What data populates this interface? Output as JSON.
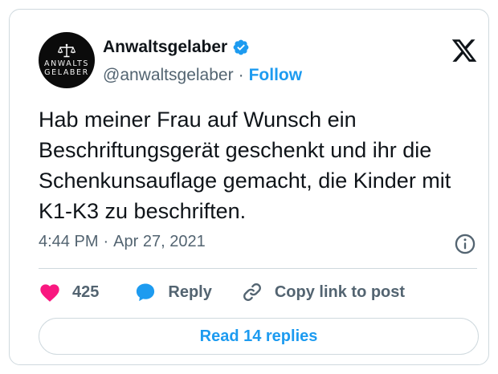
{
  "author": {
    "display_name": "Anwaltsgelaber",
    "handle": "@anwaltsgelaber",
    "separator": "·",
    "follow_label": "Follow",
    "avatar_text_top": "ANWALTS",
    "avatar_text_bottom": "GELABER",
    "verified": true
  },
  "tweet": {
    "text": "Hab meiner Frau auf Wunsch ein Beschriftungsgerät geschenkt und ihr die Schenkunsauflage gemacht, die Kinder mit K1-K3 zu beschriften.",
    "time": "4:44 PM",
    "date_separator": "·",
    "date": "Apr 27, 2021"
  },
  "actions": {
    "like_count": "425",
    "reply_label": "Reply",
    "copy_link_label": "Copy link to post"
  },
  "footer": {
    "read_replies_label": "Read 14 replies"
  },
  "colors": {
    "accent": "#1d9bf0",
    "like": "#f91880",
    "muted_text": "#536471",
    "border": "#cfd9de"
  },
  "icons": [
    "x-logo-icon",
    "verified-badge-icon",
    "scales-of-justice-icon",
    "info-icon",
    "heart-icon",
    "reply-bubble-icon",
    "link-icon"
  ]
}
